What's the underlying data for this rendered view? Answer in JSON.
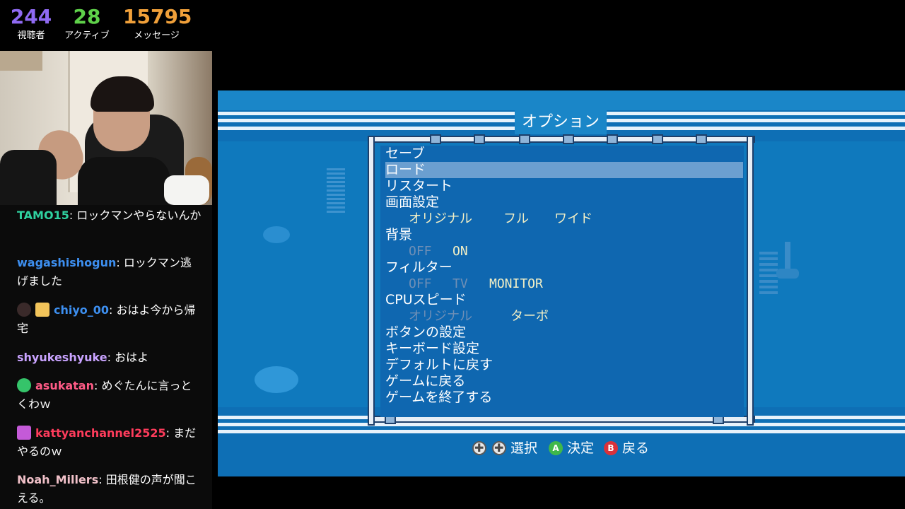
{
  "stats": {
    "viewers": {
      "value": "244",
      "label": "視聴者",
      "color": "#8f6af2"
    },
    "active": {
      "value": "28",
      "label": "アクティブ",
      "color": "#5fd14a"
    },
    "messages": {
      "value": "15795",
      "label": "メッセージ",
      "color": "#f0a03a"
    }
  },
  "chat": [
    {
      "user": "TAMO15",
      "user_color": "#2fd2a0",
      "text": "ロックマンやらないんか",
      "badges": []
    },
    {
      "user": "wagashishogun",
      "user_color": "#3d8ff0",
      "text": "ロックマン逃げました",
      "badges": []
    },
    {
      "user": "chiyo_00",
      "user_color": "#3d8ff0",
      "text": "おはよ今から帰宅",
      "badges": [
        "avatar-badge-icon",
        "box-badge-icon"
      ]
    },
    {
      "user": "shyukeshyuke",
      "user_color": "#c9a3ff",
      "text": "おはよ",
      "badges": []
    },
    {
      "user": "asukatan",
      "user_color": "#ff5b86",
      "text": "めぐたんに言っとくわｗ",
      "badges": [
        "verified-badge-icon"
      ]
    },
    {
      "user": "kattyanchannel2525",
      "user_color": "#ff3c5c",
      "text": "まだやるのｗ",
      "badges": [
        "gift-badge-icon"
      ]
    },
    {
      "user": "Noah_Millers",
      "user_color": "#f0c0c8",
      "text": "田根健の声が聞こえる。",
      "badges": []
    }
  ],
  "game": {
    "title": "オプション",
    "menu": {
      "save": "セーブ",
      "load": "ロード",
      "restart": "リスタート",
      "screen_settings": "画面設定",
      "screen_options": [
        "オリジナル",
        "フル",
        "ワイド"
      ],
      "background": "背景",
      "background_options": [
        "OFF",
        "ON"
      ],
      "filter": "フィルター",
      "filter_options": [
        "OFF",
        "TV",
        "MONITOR"
      ],
      "cpu_speed": "CPUスピード",
      "cpu_options": [
        "オリジナル",
        "ターボ"
      ],
      "button_settings": "ボタンの設定",
      "keyboard_settings": "キーボード設定",
      "reset_default": "デフォルトに戻す",
      "return_game": "ゲームに戻る",
      "quit_game": "ゲームを終了する"
    },
    "selected_item": "ロード",
    "hints": {
      "select": "選択",
      "confirm": "決定",
      "back": "戻る",
      "a_button": "A",
      "b_button": "B"
    },
    "colors": {
      "a_button": "#3fb84a",
      "b_button": "#d9323b",
      "selected_row": "#6b9fd0"
    }
  }
}
